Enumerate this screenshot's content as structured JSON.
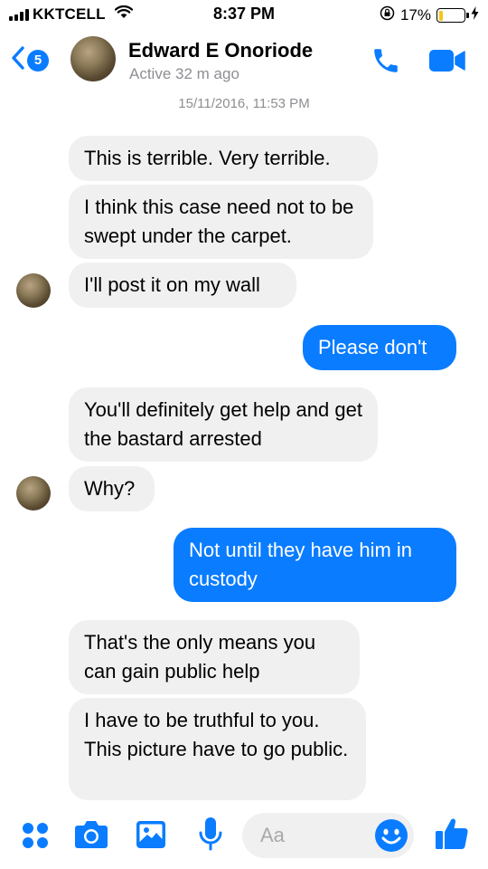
{
  "status_bar": {
    "carrier": "KKTCELL",
    "time": "8:37 PM",
    "battery_percent": "17%",
    "battery_level": 0.17,
    "icons": [
      "signal-bars",
      "wifi",
      "orientation-lock",
      "battery",
      "charging-bolt"
    ]
  },
  "header": {
    "back_count": "5",
    "contact_name": "Edward E Onoriode",
    "contact_status": "Active 32 m ago",
    "icons": [
      "back-chevron",
      "phone",
      "video-camera"
    ]
  },
  "conversation": {
    "date_stamp": "15/11/2016, 11:53 PM",
    "messages": [
      {
        "sender": "them",
        "text": "This is terrible. Very terrible."
      },
      {
        "sender": "them",
        "text": "I think this case need not to be swept under the carpet."
      },
      {
        "sender": "them",
        "text": "I'll post it on my wall"
      },
      {
        "sender": "me",
        "text": "Please don't"
      },
      {
        "sender": "them",
        "text": "You'll definitely get help and get the bastard arrested"
      },
      {
        "sender": "them",
        "text": "Why?"
      },
      {
        "sender": "me",
        "text": "Not until they have him in custody"
      },
      {
        "sender": "them",
        "text": "That's the only means you can gain public help"
      },
      {
        "sender": "them",
        "text": "I have to be truthful to you. This picture have to go public."
      }
    ]
  },
  "composer": {
    "placeholder": "Aa",
    "icons": [
      "more-dots",
      "camera",
      "gallery",
      "microphone",
      "emoji",
      "thumbs-up"
    ]
  },
  "colors": {
    "accent": "#0a7cff",
    "incoming_bubble": "#f1f0f0",
    "secondary_text": "#8e8e93",
    "battery_low": "#f5c518"
  }
}
